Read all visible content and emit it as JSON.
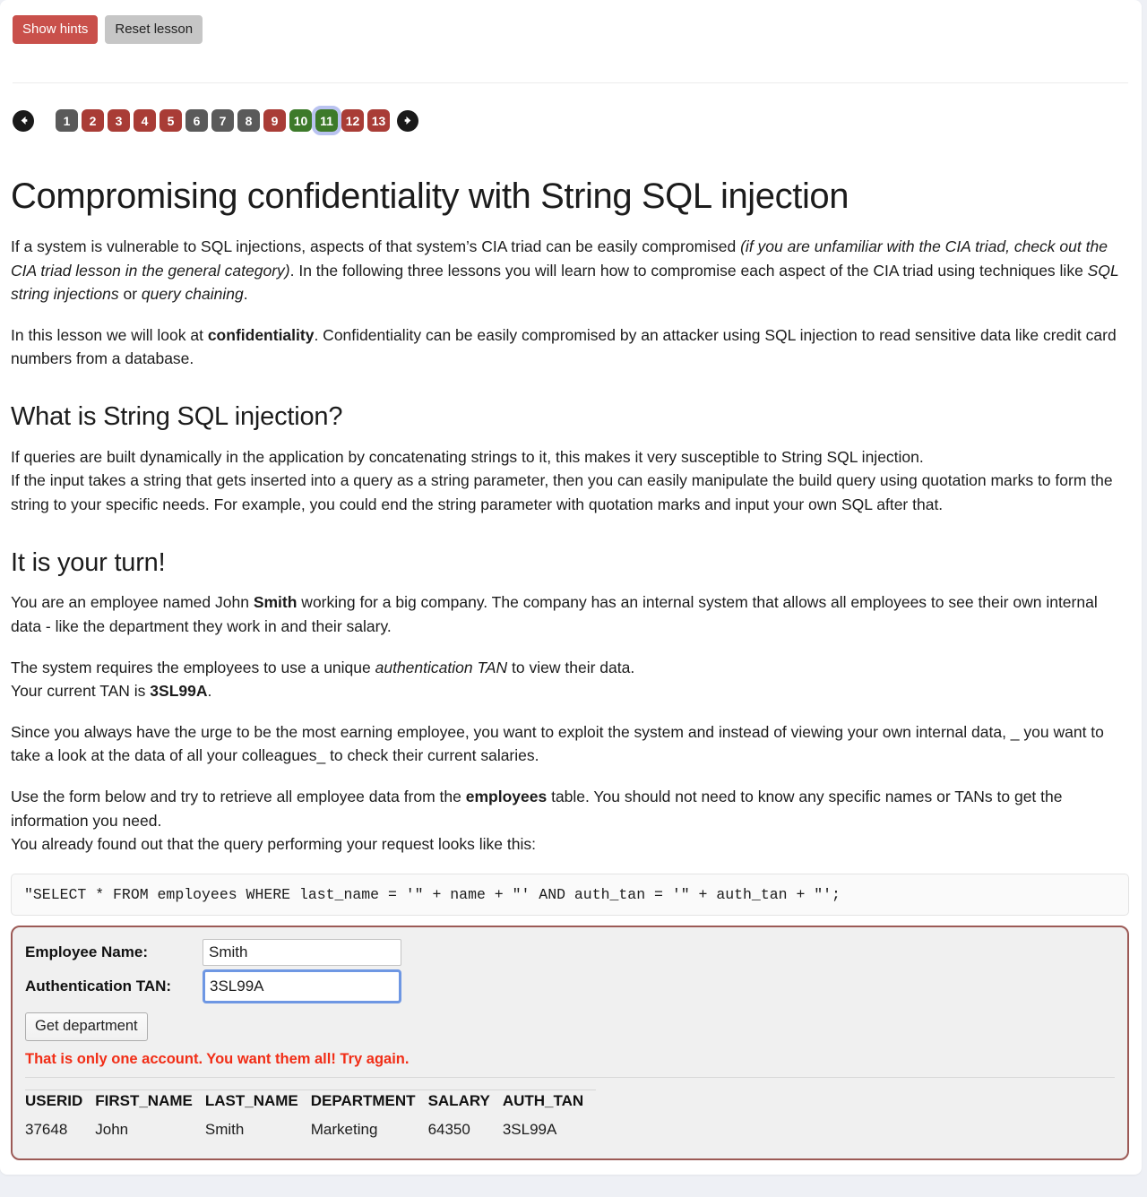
{
  "toolbar": {
    "show_hints_label": "Show hints",
    "reset_lesson_label": "Reset lesson"
  },
  "pagination": {
    "prev_icon": "arrow-left-icon",
    "next_icon": "arrow-right-icon",
    "current": "11",
    "items": [
      {
        "label": "1",
        "state": "gray"
      },
      {
        "label": "2",
        "state": "red"
      },
      {
        "label": "3",
        "state": "red"
      },
      {
        "label": "4",
        "state": "red"
      },
      {
        "label": "5",
        "state": "red"
      },
      {
        "label": "6",
        "state": "gray"
      },
      {
        "label": "7",
        "state": "gray"
      },
      {
        "label": "8",
        "state": "gray"
      },
      {
        "label": "9",
        "state": "red"
      },
      {
        "label": "10",
        "state": "green"
      },
      {
        "label": "11",
        "state": "green"
      },
      {
        "label": "12",
        "state": "red"
      },
      {
        "label": "13",
        "state": "red"
      }
    ]
  },
  "lesson": {
    "title": "Compromising confidentiality with String SQL injection",
    "intro_p1_a": "If a system is vulnerable to SQL injections, aspects of that system’s CIA triad can be easily compromised ",
    "intro_p1_i1": "(if you are unfamiliar with the CIA triad, check out the CIA triad lesson in the general category)",
    "intro_p1_b": ". In the following three lessons you will learn how to compromise each aspect of the CIA triad using techniques like ",
    "intro_p1_i2": "SQL string injections",
    "intro_p1_c": " or ",
    "intro_p1_i3": "query chaining",
    "intro_p1_d": ".",
    "intro_p2_a": "In this lesson we will look at ",
    "intro_p2_bold": "confidentiality",
    "intro_p2_b": ". Confidentiality can be easily compromised by an attacker using SQL injection to read sensitive data like credit card numbers from a database.",
    "heading_what": "What is String SQL injection?",
    "what_p1": "If queries are built dynamically in the application by concatenating strings to it, this makes it very susceptible to String SQL injection.",
    "what_p2": "If the input takes a string that gets inserted into a query as a string parameter, then you can easily manipulate the build query using quotation marks to form the string to your specific needs. For example, you could end the string parameter with quotation marks and input your own SQL after that.",
    "heading_turn": "It is your turn!",
    "turn_p1_a": "You are an employee named John ",
    "turn_p1_bold": "Smith",
    "turn_p1_b": " working for a big company. The company has an internal system that allows all employees to see their own internal data - like the department they work in and their salary.",
    "turn_p2_a": "The system requires the employees to use a unique ",
    "turn_p2_i": "authentication TAN",
    "turn_p2_b": " to view their data.",
    "turn_p2_line2_a": "Your current TAN is ",
    "turn_p2_line2_bold": "3SL99A",
    "turn_p2_line2_b": ".",
    "turn_p3": "Since you always have the urge to be the most earning employee, you want to exploit the system and instead of viewing your own internal data, _ you want to take a look at the data of all your colleagues_ to check their current salaries.",
    "turn_p4_a": "Use the form below and try to retrieve all employee data from the ",
    "turn_p4_bold": "employees",
    "turn_p4_b": " table. You should not need to know any specific names or TANs to get the information you need.",
    "turn_p4_line2": "You already found out that the query performing your request looks like this:",
    "query_code": "\"SELECT * FROM employees WHERE last_name = '\" + name + \"' AND auth_tan = '\" + auth_tan + \"';"
  },
  "form": {
    "employee_name_label": "Employee Name:",
    "employee_name_value": "Smith",
    "employee_name_placeholder": "",
    "auth_tan_label": "Authentication TAN:",
    "auth_tan_value": "3SL99A",
    "auth_tan_placeholder": "",
    "submit_label": "Get department",
    "error_message": "That is only one account. You want them all! Try again."
  },
  "results": {
    "columns": [
      "USERID",
      "FIRST_NAME",
      "LAST_NAME",
      "DEPARTMENT",
      "SALARY",
      "AUTH_TAN"
    ],
    "rows": [
      {
        "userid": "37648",
        "first_name": "John",
        "last_name": "Smith",
        "department": "Marketing",
        "salary": "64350",
        "auth_tan": "3SL99A"
      }
    ]
  },
  "colors": {
    "hints_button": "#c9504b",
    "reset_button": "#c6c6c6",
    "page_red": "#a93c36",
    "page_green": "#3d7a2a",
    "page_gray": "#5a5a5a",
    "current_ring": "#b9c2f0",
    "panel_border": "#9c5a56",
    "error_text": "#f12d16",
    "focus_ring": "#6e97e3"
  }
}
